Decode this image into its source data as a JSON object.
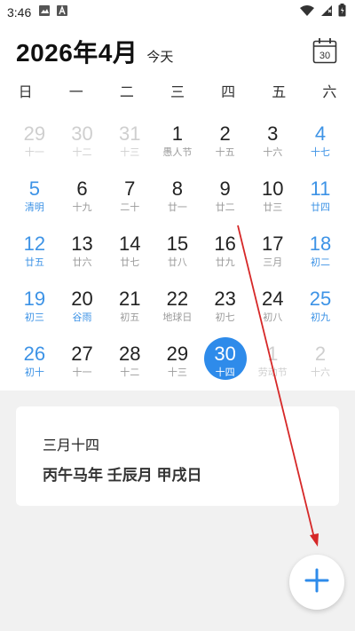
{
  "status_bar": {
    "time": "3:46",
    "icons": [
      "image-icon",
      "text-box-icon",
      "wifi-icon",
      "signal-icon",
      "battery-icon"
    ]
  },
  "calendar": {
    "title": "2026年4月",
    "today_label": "今天",
    "calendar_icon_number": "30",
    "weekdays": [
      "日",
      "一",
      "二",
      "三",
      "四",
      "五",
      "六"
    ],
    "weeks": [
      [
        {
          "day": "29",
          "lunar": "十一",
          "state": "muted"
        },
        {
          "day": "30",
          "lunar": "十二",
          "state": "muted"
        },
        {
          "day": "31",
          "lunar": "十三",
          "state": "muted"
        },
        {
          "day": "1",
          "lunar": "愚人节",
          "state": "normal"
        },
        {
          "day": "2",
          "lunar": "十五",
          "state": "normal"
        },
        {
          "day": "3",
          "lunar": "十六",
          "state": "normal"
        },
        {
          "day": "4",
          "lunar": "十七",
          "state": "weekend"
        }
      ],
      [
        {
          "day": "5",
          "lunar": "清明",
          "state": "weekend"
        },
        {
          "day": "6",
          "lunar": "十九",
          "state": "normal"
        },
        {
          "day": "7",
          "lunar": "二十",
          "state": "normal"
        },
        {
          "day": "8",
          "lunar": "廿一",
          "state": "normal"
        },
        {
          "day": "9",
          "lunar": "廿二",
          "state": "normal"
        },
        {
          "day": "10",
          "lunar": "廿三",
          "state": "normal"
        },
        {
          "day": "11",
          "lunar": "廿四",
          "state": "weekend"
        }
      ],
      [
        {
          "day": "12",
          "lunar": "廿五",
          "state": "weekend"
        },
        {
          "day": "13",
          "lunar": "廿六",
          "state": "normal"
        },
        {
          "day": "14",
          "lunar": "廿七",
          "state": "normal"
        },
        {
          "day": "15",
          "lunar": "廿八",
          "state": "normal"
        },
        {
          "day": "16",
          "lunar": "廿九",
          "state": "normal"
        },
        {
          "day": "17",
          "lunar": "三月",
          "state": "normal"
        },
        {
          "day": "18",
          "lunar": "初二",
          "state": "weekend"
        }
      ],
      [
        {
          "day": "19",
          "lunar": "初三",
          "state": "weekend"
        },
        {
          "day": "20",
          "lunar": "谷雨",
          "state": "holiday"
        },
        {
          "day": "21",
          "lunar": "初五",
          "state": "normal"
        },
        {
          "day": "22",
          "lunar": "地球日",
          "state": "normal"
        },
        {
          "day": "23",
          "lunar": "初七",
          "state": "normal"
        },
        {
          "day": "24",
          "lunar": "初八",
          "state": "normal"
        },
        {
          "day": "25",
          "lunar": "初九",
          "state": "weekend"
        }
      ],
      [
        {
          "day": "26",
          "lunar": "初十",
          "state": "weekend"
        },
        {
          "day": "27",
          "lunar": "十一",
          "state": "normal"
        },
        {
          "day": "28",
          "lunar": "十二",
          "state": "normal"
        },
        {
          "day": "29",
          "lunar": "十三",
          "state": "normal"
        },
        {
          "day": "30",
          "lunar": "十四",
          "state": "selected"
        },
        {
          "day": "1",
          "lunar": "劳动节",
          "state": "muted"
        },
        {
          "day": "2",
          "lunar": "十六",
          "state": "muted"
        }
      ]
    ]
  },
  "info_card": {
    "lunar_date": "三月十四",
    "ganzhi": "丙午马年 壬辰月 甲戌日"
  },
  "fab": {
    "icon": "plus-icon"
  },
  "colors": {
    "accent": "#2e8bea",
    "weekend": "#3d93e6",
    "annotation_arrow": "#d62828"
  }
}
